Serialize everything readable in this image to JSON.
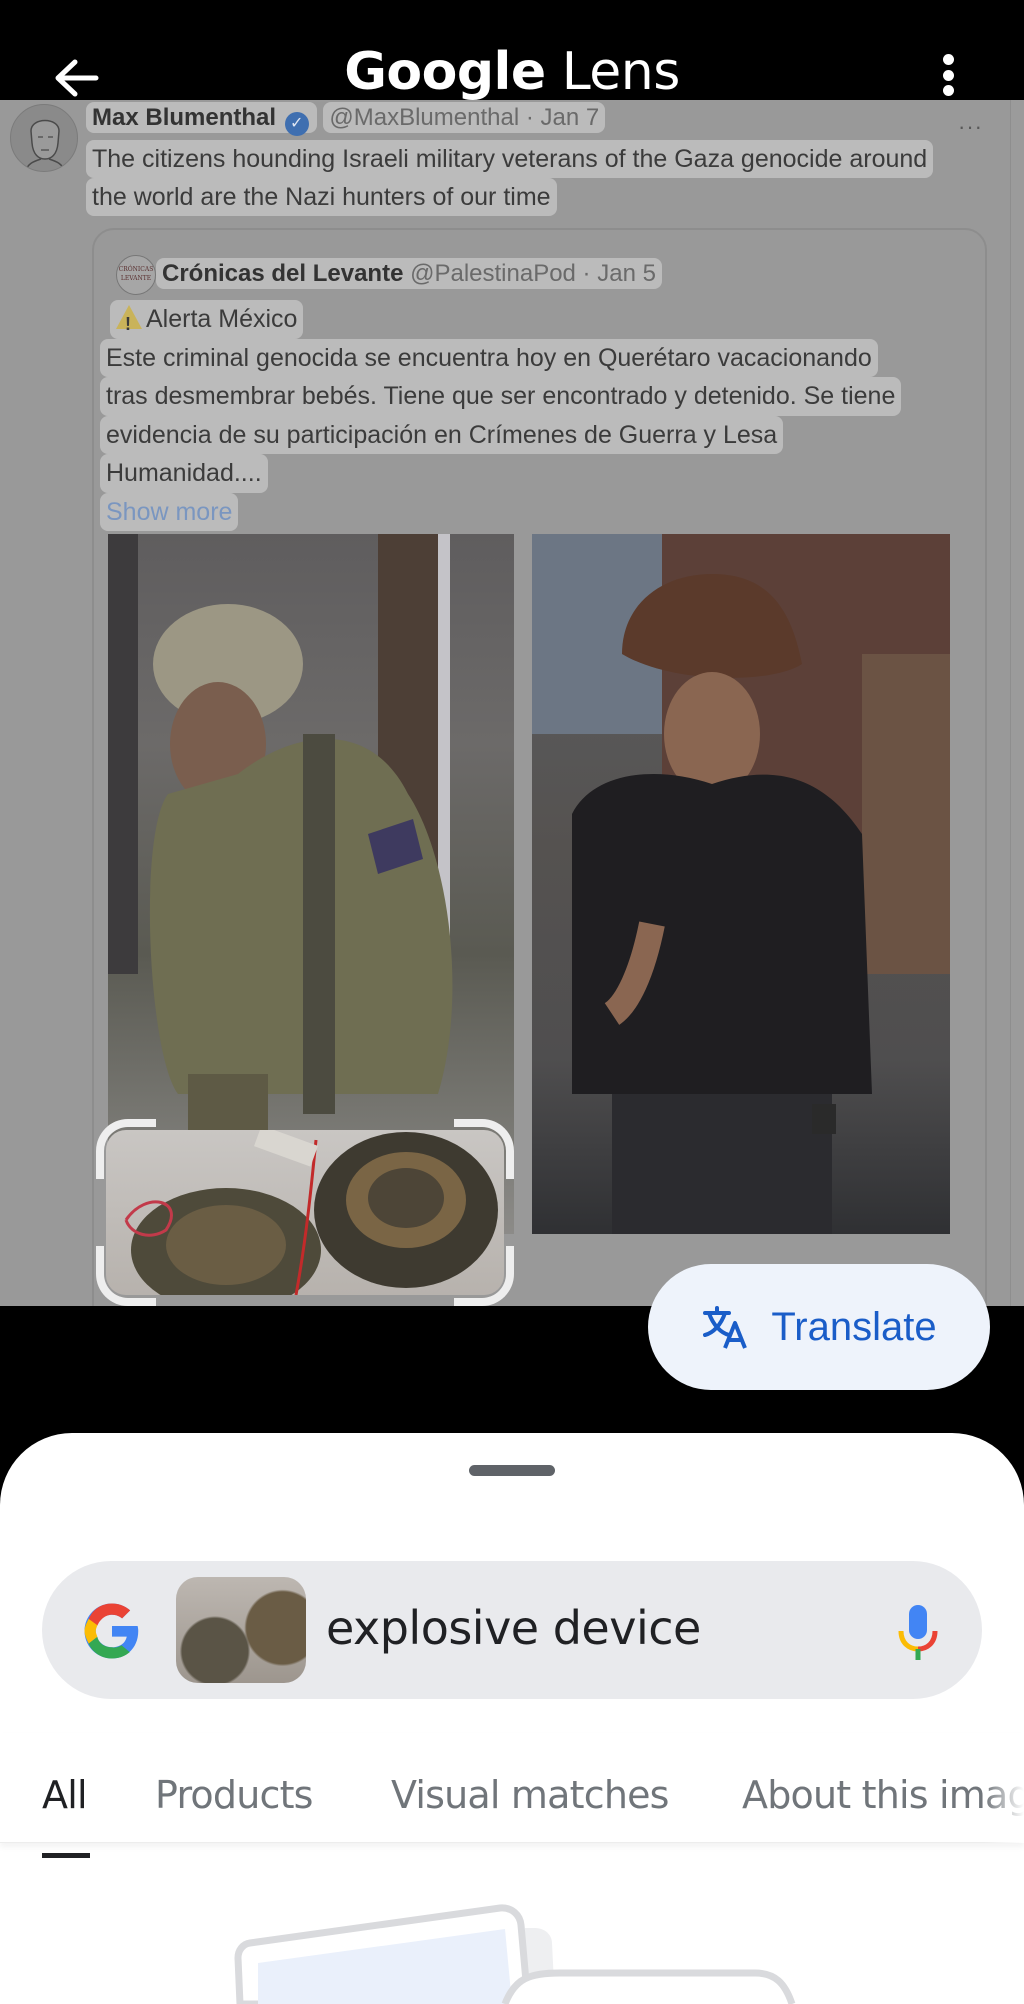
{
  "appbar": {
    "title_google": "Google",
    "title_lens": "Lens",
    "back_icon": "arrow-left-icon",
    "more_icon": "more-vert-icon"
  },
  "capture": {
    "tweet": {
      "author": "Max Blumenthal",
      "verified": true,
      "handle_date": "@MaxBlumenthal · Jan 7",
      "more": "···",
      "lines": [
        "The citizens hounding Israeli military veterans of the Gaza genocide around",
        "the world are the Nazi hunters of our time"
      ]
    },
    "quote": {
      "avatar_text_top": "CRÓNICAS",
      "avatar_text_bottom": "LEVANTE",
      "author": "Crónicas del Levante",
      "handle_date": "@PalestinaPod · Jan 5",
      "alert": "Alerta México",
      "lines": [
        "Este criminal genocida se encuentra hoy en Querétaro vacacionando",
        "tras desmembrar bebés. Tiene que ser encontrado y detenido. Se tiene",
        "evidencia de su participación en Crímenes de Guerra y Lesa",
        "Humanidad...."
      ],
      "show_more": "Show more",
      "images": [
        "soldier-with-explosive-devices-photo",
        "man-in-cowboy-hat-photo"
      ]
    }
  },
  "translate": {
    "label": "Translate",
    "icon": "translate-icon",
    "color": "#1a5dc8"
  },
  "sheet": {
    "search": {
      "query": "explosive device",
      "logo": "google-g-icon",
      "mic": "mic-icon"
    },
    "tabs": [
      {
        "label": "All",
        "active": true
      },
      {
        "label": "Products",
        "active": false
      },
      {
        "label": "Visual matches",
        "active": false
      },
      {
        "label": "About this image",
        "active": false
      }
    ]
  }
}
